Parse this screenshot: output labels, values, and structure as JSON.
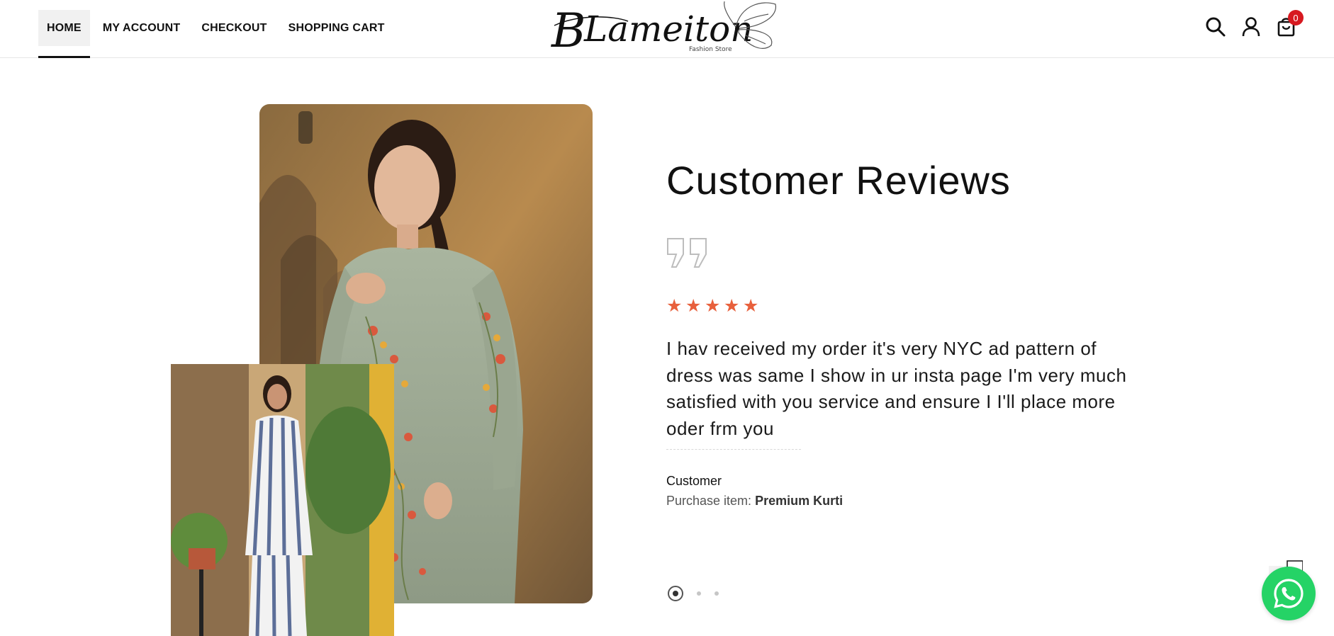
{
  "nav": {
    "items": [
      {
        "label": "HOME",
        "active": true
      },
      {
        "label": "MY ACCOUNT"
      },
      {
        "label": "CHECKOUT"
      },
      {
        "label": "SHOPPING CART"
      }
    ]
  },
  "logo": {
    "text": "B Lameiton",
    "tagline": "Fashion Store"
  },
  "header_icons": [
    "search-icon",
    "user-icon",
    "cart-icon"
  ],
  "cart": {
    "count": "0"
  },
  "reviews": {
    "title": "Customer Reviews",
    "rating": 5,
    "text": "I hav received my order it's very NYC ad pattern of dress was same I show in ur insta page I'm very much satisfied with you service and ensure I I'll place more oder frm you",
    "reviewer": "Customer",
    "purchase_label": "Purchase item:",
    "purchase_item": "Premium Kurti"
  },
  "pagination": {
    "total": 3,
    "current": 1
  },
  "colors": {
    "star": "#e8603c",
    "badge": "#d71920",
    "whatsapp": "#25d366"
  }
}
